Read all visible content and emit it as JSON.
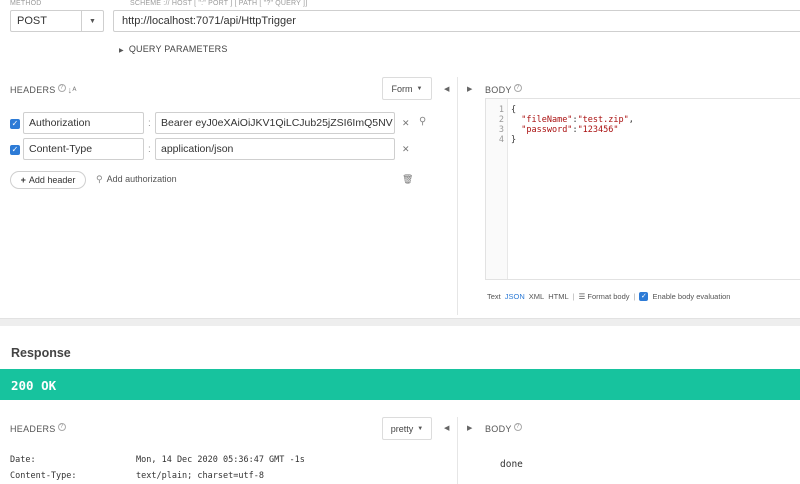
{
  "request": {
    "method_label": "METHOD",
    "scheme_label": "SCHEME :// HOST [ \":\" PORT ] [ PATH [ \"?\" QUERY ]]",
    "method": "POST",
    "url": "http://localhost:7071/api/HttpTrigger",
    "query_parameters_label": "QUERY PARAMETERS"
  },
  "headers_section": {
    "title": "HEADERS",
    "form_button": "Form",
    "rows": [
      {
        "name": "Authorization",
        "value": "Bearer eyJ0eXAiOiJKV1QiLCJub25jZSI6ImQ5NV",
        "checked": true
      },
      {
        "name": "Content-Type",
        "value": "application/json",
        "checked": true
      }
    ],
    "add_header": "Add header",
    "add_authorization": "Add authorization"
  },
  "body_section": {
    "title": "BODY",
    "lines": [
      {
        "n": "1",
        "text": "{"
      },
      {
        "n": "2",
        "key": "\"fileName\"",
        "value": "\"test.zip\"",
        "suffix": ","
      },
      {
        "n": "3",
        "key": "\"password\"",
        "value": "\"123456\"",
        "suffix": ""
      },
      {
        "n": "4",
        "text": "}"
      }
    ],
    "footer": {
      "text": "Text",
      "json": "JSON",
      "xml": "XML",
      "html": "HTML",
      "format_body": "Format body",
      "enable_eval": "Enable body evaluation"
    }
  },
  "response": {
    "title": "Response",
    "status": "200 OK",
    "status_color": "#17c39e",
    "headers_title": "HEADERS",
    "pretty_button": "pretty",
    "body_title": "BODY",
    "headers": [
      {
        "name": "Date:",
        "value": "Mon, 14 Dec 2020 05:36:47 GMT -1s"
      },
      {
        "name": "Content-Type:",
        "value": "text/plain; charset=utf-8"
      }
    ],
    "body": "done"
  }
}
